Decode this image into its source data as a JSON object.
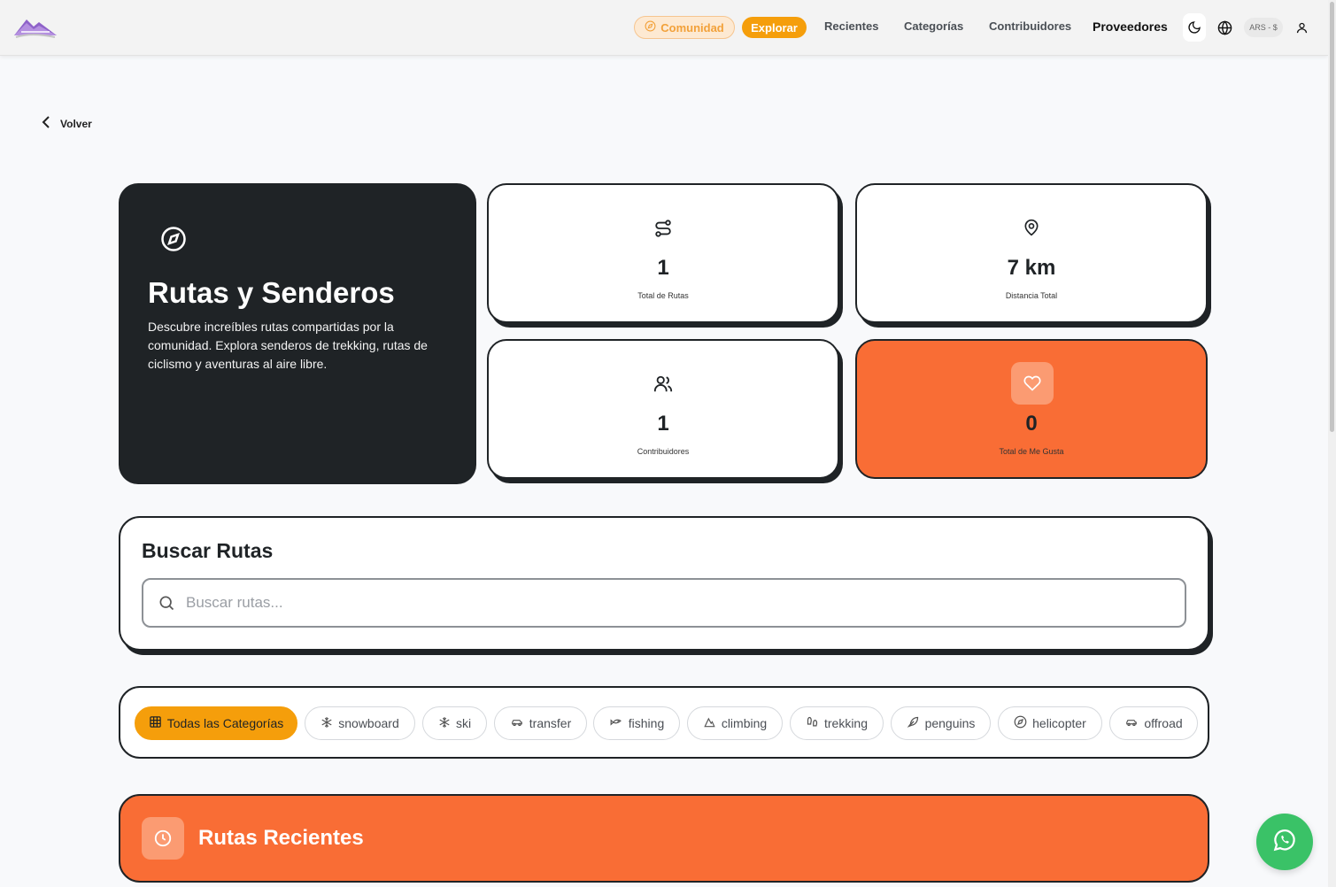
{
  "header": {
    "nav": {
      "comunidad": "Comunidad",
      "explorar": "Explorar",
      "recientes": "Recientes",
      "categorias": "Categorías",
      "contribuidores": "Contribuidores",
      "proveedores": "Proveedores"
    },
    "currency": "ARS - $",
    "accent": "#f59e0b"
  },
  "back": {
    "label": "Volver"
  },
  "hero": {
    "title": "Rutas y Senderos",
    "description": "Descubre increíbles rutas compartidas por la comunidad. Explora senderos de trekking, rutas de ciclismo y aventuras al aire libre.",
    "icon": "compass-icon"
  },
  "stats": {
    "routes": {
      "value": "1",
      "label": "Total de Rutas",
      "icon": "route-icon"
    },
    "distance": {
      "value": "7 km",
      "label": "Distancia Total",
      "icon": "map-pin-icon"
    },
    "contributors": {
      "value": "1",
      "label": "Contribuidores",
      "icon": "users-icon"
    },
    "likes": {
      "value": "0",
      "label": "Total de Me Gusta",
      "icon": "heart-icon",
      "color": "#f96d35"
    }
  },
  "search": {
    "title": "Buscar Rutas",
    "placeholder": "Buscar rutas...",
    "value": ""
  },
  "categories": {
    "items": [
      {
        "label": "Todas las Categorías",
        "icon": "grid-icon",
        "active": true
      },
      {
        "label": "snowboard",
        "icon": "snowflake-icon"
      },
      {
        "label": "ski",
        "icon": "snowflake-icon"
      },
      {
        "label": "transfer",
        "icon": "car-icon"
      },
      {
        "label": "fishing",
        "icon": "fish-icon"
      },
      {
        "label": "climbing",
        "icon": "mountain-icon"
      },
      {
        "label": "trekking",
        "icon": "footprints-icon"
      },
      {
        "label": "penguins",
        "icon": "bird-icon"
      },
      {
        "label": "helicopter",
        "icon": "compass-icon"
      },
      {
        "label": "offroad",
        "icon": "car-icon"
      }
    ]
  },
  "recent": {
    "title": "Rutas Recientes",
    "icon": "clock-icon"
  }
}
